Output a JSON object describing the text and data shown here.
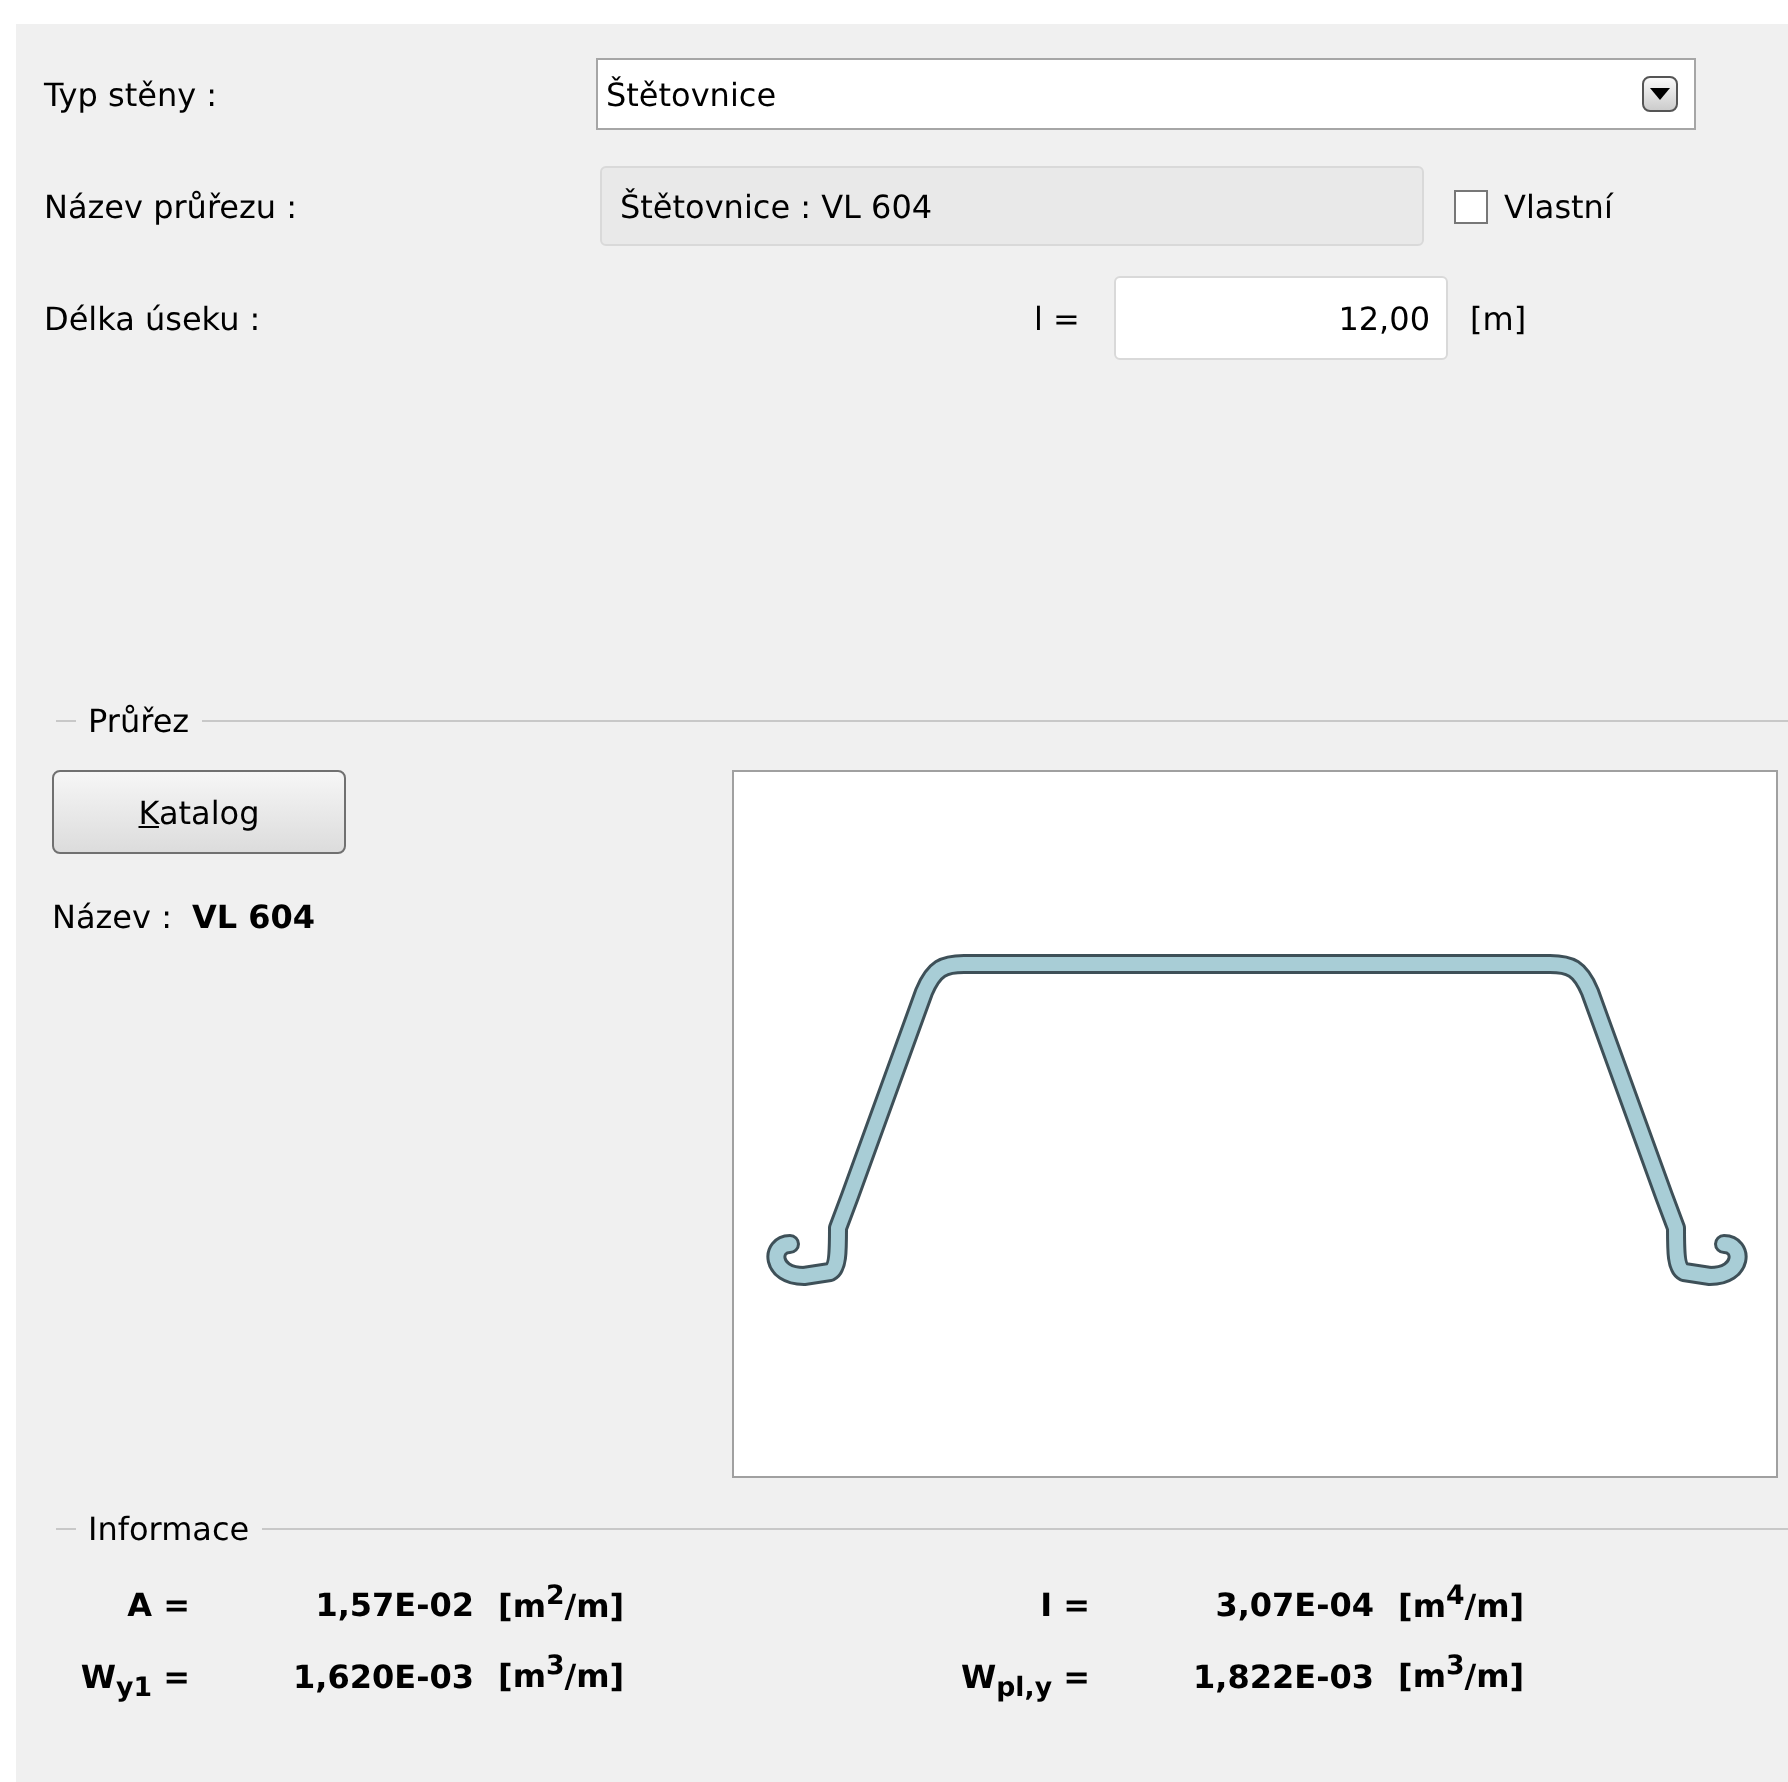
{
  "form": {
    "rows": [
      {
        "kind": "dropdown",
        "label": "Typ stěny :",
        "value": "Štětovnice"
      },
      {
        "kind": "readonly",
        "label": "Název průřezu :",
        "value": "Štětovnice : VL 604",
        "checkbox": {
          "label": "Vlastní",
          "checked": false
        }
      },
      {
        "kind": "number",
        "label": "Délka úseku :",
        "prefix": "l =",
        "value": "12,00",
        "unit": "[m]"
      }
    ]
  },
  "section": {
    "title": "Průřez",
    "button": {
      "label": "Katalog",
      "mnemonic": true
    },
    "name_label": "Název :",
    "name_value": "VL 604"
  },
  "info": {
    "title": "Informace",
    "items": [
      {
        "label": "A =",
        "value": "1,57E-02",
        "unit": "[m$^{2}$/m]"
      },
      {
        "label": "I =",
        "value": "3,07E-04",
        "unit": "[m$^{4}$/m]"
      },
      {
        "label": "W$_{y1}$ =",
        "value": "1,620E-03",
        "unit": "[m$^{3}$/m]"
      },
      {
        "label": "W$_{pl,y}$ =",
        "value": "1,822E-03",
        "unit": "[m$^{3}$/m]"
      }
    ]
  }
}
